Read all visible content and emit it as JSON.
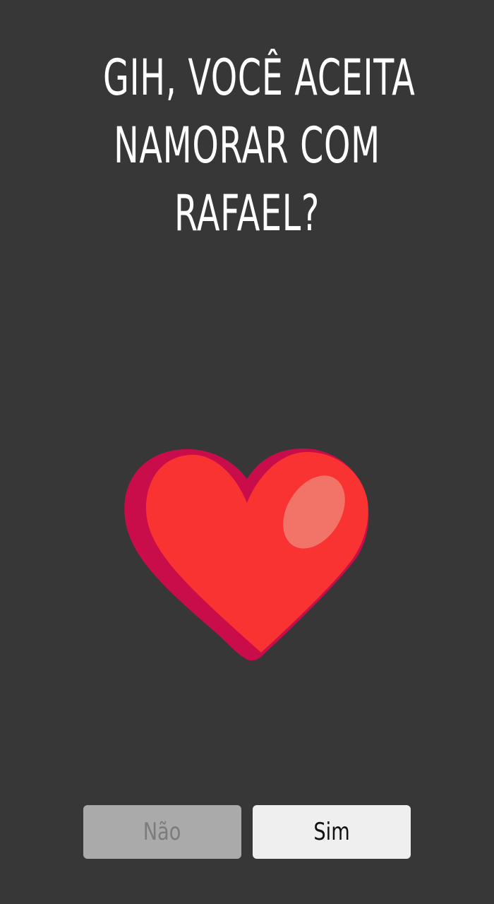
{
  "question": {
    "lines": [
      "GIH, VOCÊ ACEITA",
      "NAMORAR COM",
      "RAFAEL?"
    ]
  },
  "illustration": {
    "icon": "heart-icon",
    "colors": {
      "main": "#f93232",
      "shadow": "#c90d4a",
      "highlight": "#f27468"
    }
  },
  "buttons": {
    "no_label": "Não",
    "yes_label": "Sim"
  },
  "colors": {
    "background": "#373737",
    "title": "#ffffff",
    "no_button_bg": "#aaaaaa",
    "no_button_text": "#7c7c7c",
    "yes_button_bg": "#efefef",
    "yes_button_text": "#111111"
  }
}
